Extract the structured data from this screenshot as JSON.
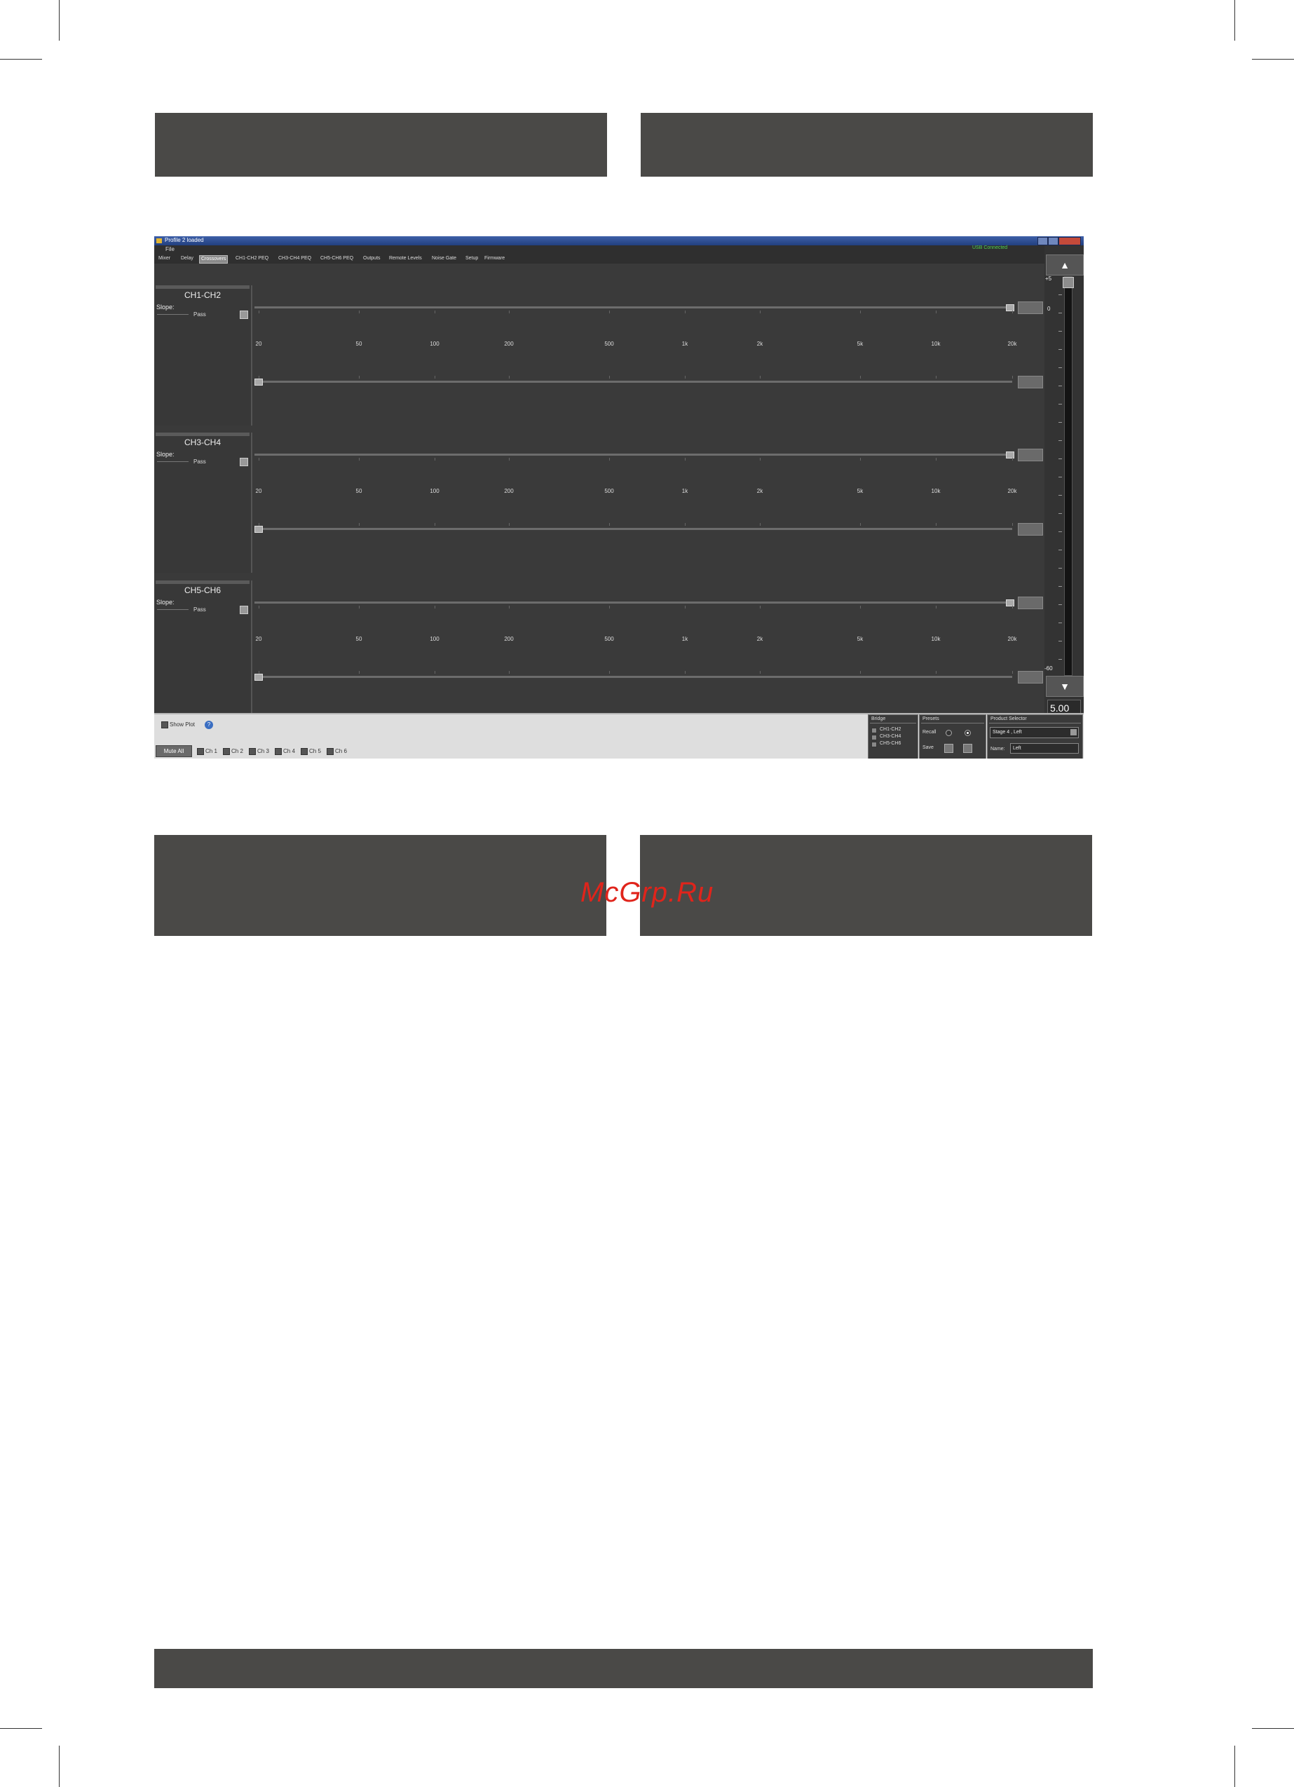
{
  "watermark": "McGrp.Ru",
  "titlebar": {
    "title": "Profile 2 loaded"
  },
  "menubar": {
    "file": "File",
    "status": "USB Connected"
  },
  "tabs": [
    {
      "label": "Mixer"
    },
    {
      "label": "Delay"
    },
    {
      "label": "Crossovers",
      "active": true
    },
    {
      "label": "CH1-CH2 PEQ"
    },
    {
      "label": "CH3-CH4 PEQ"
    },
    {
      "label": "CH5-CH6 PEQ"
    },
    {
      "label": "Outputs"
    },
    {
      "label": "Remote Levels"
    },
    {
      "label": "Noise Gate"
    },
    {
      "label": "Setup"
    },
    {
      "label": "Firmware"
    }
  ],
  "channels": [
    {
      "title": "CH1-CH2",
      "slope_label": "Slope:",
      "type": "Pass"
    },
    {
      "title": "CH3-CH4",
      "slope_label": "Slope:",
      "type": "Pass"
    },
    {
      "title": "CH5-CH6",
      "slope_label": "Slope:",
      "type": "Pass"
    }
  ],
  "freq_labels": [
    "20",
    "50",
    "100",
    "200",
    "500",
    "1k",
    "2k",
    "5k",
    "10k",
    "20k"
  ],
  "gain": {
    "top_label": "+5",
    "zero_label": "0",
    "bottom_label": "-60",
    "value": "5.00",
    "up_arrow": "▲",
    "down_arrow": "▼"
  },
  "bottom": {
    "show_plot": "Show Plot",
    "help": "?",
    "mute_all": "Mute All",
    "channels": [
      "Ch 1",
      "Ch 2",
      "Ch 3",
      "Ch 4",
      "Ch 5",
      "Ch 6"
    ],
    "bridge": {
      "title": "Bridge",
      "items": [
        "CH1-CH2",
        "CH3-CH4",
        "CH5-CH6"
      ]
    },
    "presets": {
      "title": "Presets",
      "recall": "Recall",
      "save": "Save"
    },
    "product": {
      "title": "Product Selector",
      "selected": "Stage 4 , Left",
      "name_label": "Name:",
      "name_value": "Left"
    }
  },
  "colors": {
    "accent_blue": "#3a6ec2",
    "usb_green": "#4fd04f",
    "panel": "#3a3a3a",
    "band": "#4a4947"
  }
}
